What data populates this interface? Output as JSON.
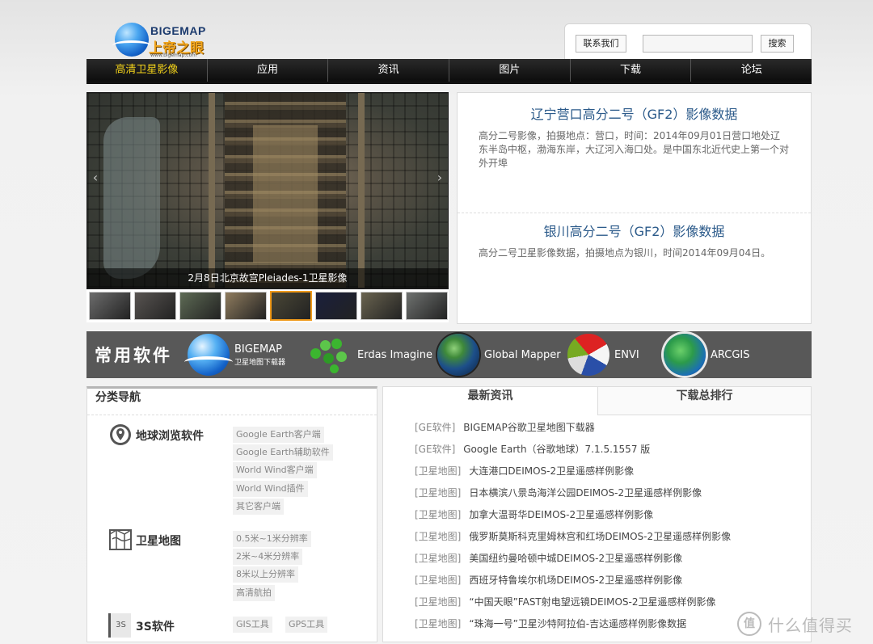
{
  "header": {
    "logo_en": "BIGEMAP",
    "logo_cn": "上帝之眼",
    "logo_url": "www.bigemap.com",
    "contact_label": "联系我们",
    "search_value": "",
    "search_button": "搜索"
  },
  "nav": [
    "高清卫星影像",
    "应用",
    "资讯",
    "图片",
    "下载",
    "论坛"
  ],
  "slideshow": {
    "caption": "2月8日北京故宫Pleiades-1卫星影像",
    "prev_arrow": "‹",
    "next_arrow": "›",
    "thumb_colors": [
      "#6c6c6c",
      "#585451",
      "#5e6b55",
      "#8f7c5e",
      "#4a4736",
      "#1a1f3c",
      "#6a6450",
      "#6f7270"
    ]
  },
  "features": [
    {
      "title": "辽宁营口高分二号（GF2）影像数据",
      "desc": "高分二号影像，拍摄地点：营口，时间：2014年09月01日营口地处辽东半岛中枢，渤海东岸，大辽河入海口处。是中国东北近代史上第一个对外开埠"
    },
    {
      "title": "银川高分二号（GF2）影像数据",
      "desc": "高分二号卫星影像数据，拍摄地点为银川，时间2014年09月04日。"
    }
  ],
  "software": {
    "title": "常用软件",
    "items": [
      {
        "name": "BIGEMAP",
        "sub": "卫星地图下载器"
      },
      {
        "name": "Erdas Imagine",
        "sub": ""
      },
      {
        "name": "Global Mapper",
        "sub": ""
      },
      {
        "name": "ENVI",
        "sub": ""
      },
      {
        "name": "ARCGIS",
        "sub": ""
      }
    ]
  },
  "categories": {
    "title": "分类导航",
    "groups": [
      {
        "name": "地球浏览软件",
        "icon": "globe-pin-icon",
        "tags": [
          "Google Earth客户端",
          "Google Earth辅助软件",
          "World Wind客户端",
          "World Wind插件",
          "其它客户端"
        ]
      },
      {
        "name": "卫星地图",
        "icon": "map-icon",
        "tags": [
          "0.5米~1米分辨率",
          "2米~4米分辨率",
          "8米以上分辨率",
          "高清航拍"
        ]
      },
      {
        "name": "3S软件",
        "icon": "3s-icon",
        "icon_text": "3S",
        "tags": [
          "GIS工具",
          "GPS工具"
        ]
      }
    ]
  },
  "news": {
    "tab_latest": "最新资讯",
    "tab_download": "下载总排行",
    "items": [
      {
        "cat": "[GE软件]",
        "title": "BIGEMAP谷歌卫星地图下载器"
      },
      {
        "cat": "[GE软件]",
        "title": "Google Earth（谷歌地球）7.1.5.1557 版"
      },
      {
        "cat": "[卫星地图]",
        "title": "大连港口DEIMOS-2卫星遥感样例影像"
      },
      {
        "cat": "[卫星地图]",
        "title": "日本横滨八景岛海洋公园DEIMOS-2卫星遥感样例影像"
      },
      {
        "cat": "[卫星地图]",
        "title": "加拿大温哥华DEIMOS-2卫星遥感样例影像"
      },
      {
        "cat": "[卫星地图]",
        "title": "俄罗斯莫斯科克里姆林宫和红场DEIMOS-2卫星遥感样例影像"
      },
      {
        "cat": "[卫星地图]",
        "title": "美国纽约曼哈顿中城DEIMOS-2卫星遥感样例影像"
      },
      {
        "cat": "[卫星地图]",
        "title": "西班牙特鲁埃尔机场DEIMOS-2卫星遥感样例影像"
      },
      {
        "cat": "[卫星地图]",
        "title": "“中国天眼”FAST射电望远镜DEIMOS-2卫星遥感样例影像"
      },
      {
        "cat": "[卫星地图]",
        "title": "“珠海一号”卫星沙特阿拉伯-吉达遥感样例影像数据"
      }
    ]
  },
  "watermark": {
    "badge": "值",
    "text": "什么值得买"
  },
  "colors": {
    "nav_active": "#f3d21a",
    "feature_title": "#2b5a8a",
    "thumb_selected": "#f09a1a"
  }
}
